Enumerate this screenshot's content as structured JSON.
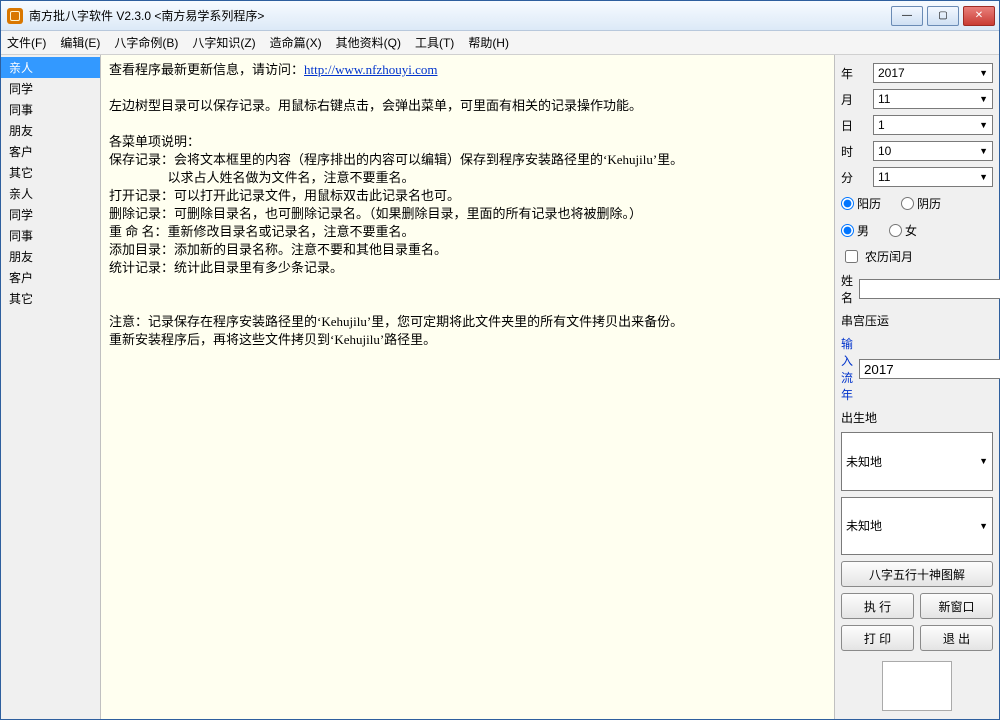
{
  "title": "南方批八字软件 V2.3.0   <南方易学系列程序>",
  "menus": [
    "文件(F)",
    "编辑(E)",
    "八字命例(B)",
    "八字知识(Z)",
    "造命篇(X)",
    "其他资料(Q)",
    "工具(T)",
    "帮助(H)"
  ],
  "sidebar": [
    "亲人",
    "同学",
    "同事",
    "朋友",
    "客户",
    "其它",
    "亲人",
    "同学",
    "同事",
    "朋友",
    "客户",
    "其它"
  ],
  "sidebar_selected": 0,
  "main": {
    "line1_prefix": "查看程序最新更新信息，请访问：",
    "link": "http://www.nfzhouyi.com",
    "para1": "左边树型目录可以保存记录。用鼠标右键点击，会弹出菜单，可里面有相关的记录操作功能。",
    "heading": "各菜单项说明：",
    "save1": "保存记录：会将文本框里的内容（程序排出的内容可以编辑）保存到程序安装路径里的‘Kehujilu’里。",
    "save2": "                  以求占人姓名做为文件名，注意不要重名。",
    "open": "打开记录：可以打开此记录文件，用鼠标双击此记录名也可。",
    "del": "删除记录：可删除目录名，也可删除记录名。（如果删除目录，里面的所有记录也将被删除。）",
    "rename": "重 命 名：重新修改目录名或记录名，注意不要重名。",
    "add": "添加目录：添加新的目录名称。注意不要和其他目录重名。",
    "stat": "统计记录：统计此目录里有多少条记录。",
    "note1": "注意：记录保存在程序安装路径里的‘Kehujilu’里，您可定期将此文件夹里的所有文件拷贝出来备份。",
    "note2": "重新安装程序后，再将这些文件拷贝到‘Kehujilu’路径里。"
  },
  "panel": {
    "year_l": "年",
    "year": "2017",
    "month_l": "月",
    "month": "11",
    "day_l": "日",
    "day": "1",
    "hour_l": "时",
    "hour": "10",
    "min_l": "分",
    "min": "11",
    "cal_solar": "阳历",
    "cal_lunar": "阴历",
    "sex_m": "男",
    "sex_f": "女",
    "leap": "农历闰月",
    "name_l": "姓名",
    "chuan": "串宫压运",
    "liunian_l": "输入流年",
    "liunian": "2017",
    "birth_l": "出生地",
    "place": "未知地",
    "btn_chart": "八字五行十神图解",
    "btn_run": "执 行",
    "btn_new": "新窗口",
    "btn_print": "打 印",
    "btn_exit": "退 出"
  }
}
